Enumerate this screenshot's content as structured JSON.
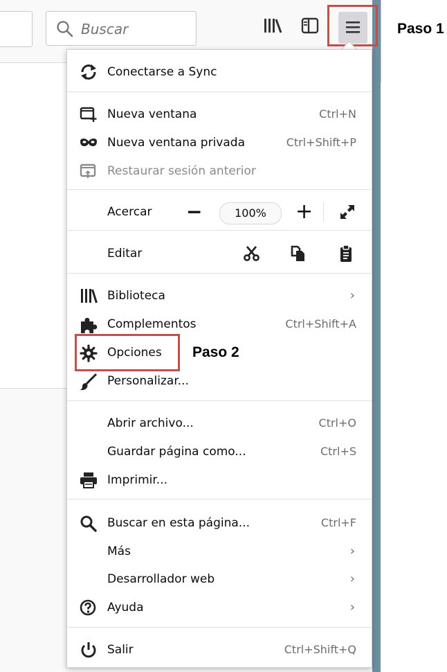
{
  "toolbar": {
    "search_placeholder": "Buscar",
    "library_icon": "library-icon",
    "sidebar_icon": "sidebar-icon",
    "menu_icon": "hamburger-menu-icon"
  },
  "annotations": {
    "step1": "Paso 1",
    "step2": "Paso 2",
    "highlight_color": "#c0504d"
  },
  "menu": {
    "sync": "Conectarse a Sync",
    "new_window": {
      "label": "Nueva ventana",
      "shortcut": "Ctrl+N"
    },
    "private_window": {
      "label": "Nueva ventana privada",
      "shortcut": "Ctrl+Shift+P"
    },
    "restore_session": "Restaurar sesión anterior",
    "zoom": {
      "label": "Acercar",
      "minus": "−",
      "value": "100%",
      "plus": "+"
    },
    "edit": {
      "label": "Editar"
    },
    "library": "Biblioteca",
    "addons": {
      "label": "Complementos",
      "shortcut": "Ctrl+Shift+A"
    },
    "options": "Opciones",
    "customize": "Personalizar...",
    "open_file": {
      "label": "Abrir archivo...",
      "shortcut": "Ctrl+O"
    },
    "save_page": {
      "label": "Guardar página como...",
      "shortcut": "Ctrl+S"
    },
    "print": "Imprimir...",
    "find": {
      "label": "Buscar en esta página...",
      "shortcut": "Ctrl+F"
    },
    "more": "Más",
    "web_developer": "Desarrollador web",
    "help": "Ayuda",
    "quit": {
      "label": "Salir",
      "shortcut": "Ctrl+Shift+Q"
    }
  }
}
